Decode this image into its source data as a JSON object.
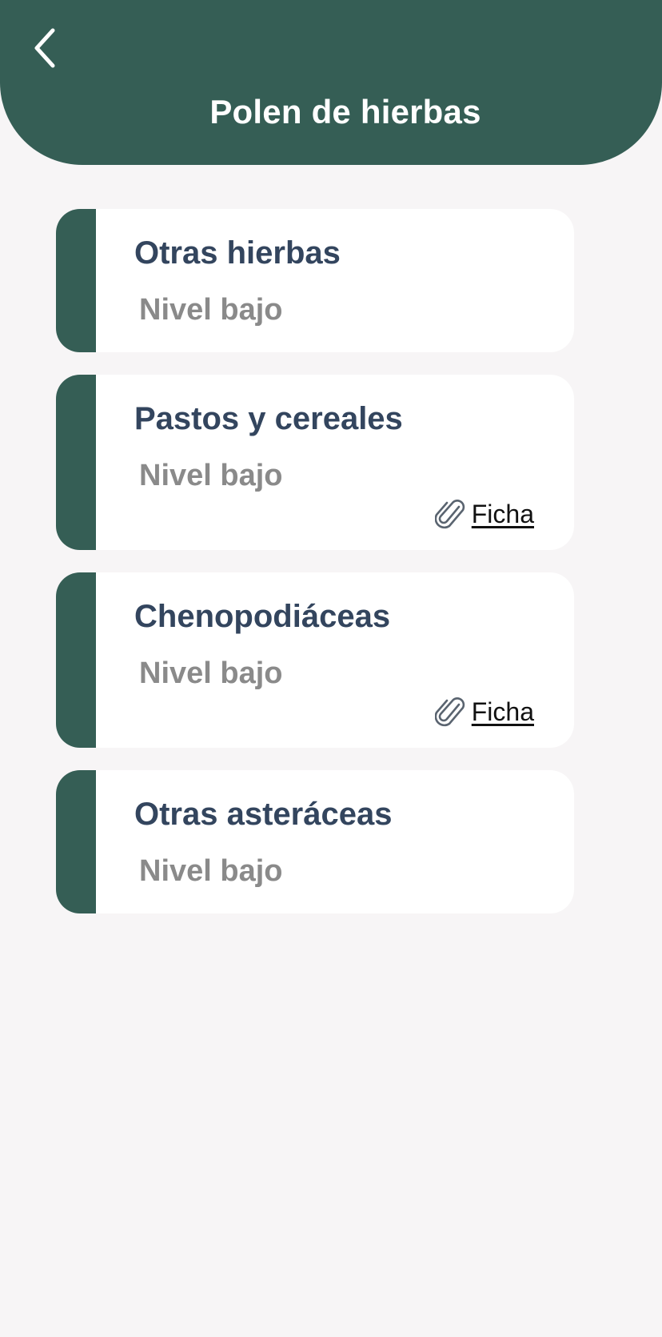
{
  "header": {
    "title": "Polen de hierbas",
    "back_icon": "chevron-left-icon"
  },
  "colors": {
    "accent": "#355e55",
    "background": "#f7f5f6",
    "title_text": "#33455e",
    "level_text": "#8a8a8a"
  },
  "cards": [
    {
      "title": "Otras hierbas",
      "level": "Nivel bajo"
    },
    {
      "title": "Pastos y cereales",
      "level": "Nivel bajo",
      "link_label": "Ficha",
      "link_icon": "paperclip-icon"
    },
    {
      "title": "Chenopodiáceas",
      "level": "Nivel bajo",
      "link_label": "Ficha",
      "link_icon": "paperclip-icon"
    },
    {
      "title": "Otras asteráceas",
      "level": "Nivel bajo"
    }
  ]
}
